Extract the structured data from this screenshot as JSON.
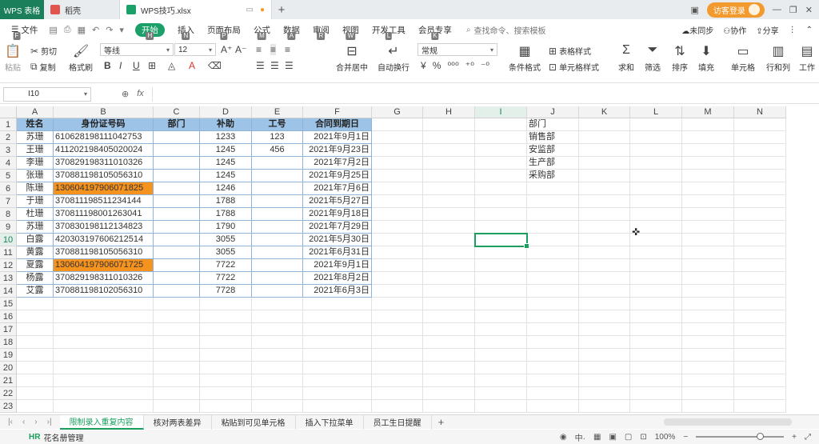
{
  "titlebar": {
    "app": "WPS 表格",
    "tabs": [
      {
        "label": "稻壳"
      },
      {
        "label": "WPS技巧.xlsx"
      }
    ],
    "new_tab": "+",
    "visitor": "访客登录"
  },
  "menu": {
    "file": "文件",
    "items": [
      {
        "label": "开始",
        "hint": "H",
        "active": true
      },
      {
        "label": "插入",
        "hint": "N"
      },
      {
        "label": "页面布局",
        "hint": "P"
      },
      {
        "label": "公式",
        "hint": "M"
      },
      {
        "label": "数据",
        "hint": "A"
      },
      {
        "label": "审阅",
        "hint": "R"
      },
      {
        "label": "视图",
        "hint": "W"
      },
      {
        "label": "开发工具",
        "hint": "L"
      },
      {
        "label": "会员专享",
        "hint": "K"
      }
    ],
    "file_hint": "F",
    "search": "查找命令、搜索模板",
    "sync": "未同步",
    "collab": "协作",
    "share": "分享"
  },
  "ribbon": {
    "paste": "粘贴",
    "cut": "剪切",
    "copy": "复制",
    "format_painter": "格式刷",
    "font_name": "等线",
    "font_size": "12",
    "merge_center": "合并居中",
    "wrap": "自动换行",
    "number_format": "常规",
    "cond_format": "条件格式",
    "table_style": "表格样式",
    "cell_style": "单元格样式",
    "sum": "求和",
    "filter": "筛选",
    "sort": "排序",
    "fill": "填充",
    "cell": "单元格",
    "row_col": "行和列",
    "work": "工作"
  },
  "formula_bar": {
    "cell_ref": "I10",
    "fx": "fx"
  },
  "columns": [
    "A",
    "B",
    "C",
    "D",
    "E",
    "F",
    "G",
    "H",
    "I",
    "J",
    "K",
    "L",
    "M",
    "N"
  ],
  "selected_column": "I",
  "selected_row": 10,
  "rows": [
    1,
    2,
    3,
    4,
    5,
    6,
    7,
    8,
    9,
    10,
    11,
    12,
    13,
    14,
    15,
    16,
    17,
    18,
    19,
    20,
    21,
    22,
    23
  ],
  "table": {
    "headers": [
      "姓名",
      "身份证号码",
      "部门",
      "补助",
      "工号",
      "合同到期日"
    ],
    "data": [
      {
        "name": "苏珊",
        "id": "610628198111042753",
        "dept": "",
        "subsidy": "1233",
        "emp_no": "123",
        "date": "2021年9月1日",
        "hl": false
      },
      {
        "name": "王珊",
        "id": "411202198405020024",
        "dept": "",
        "subsidy": "1245",
        "emp_no": "456",
        "date": "2021年9月23日",
        "hl": false
      },
      {
        "name": "李珊",
        "id": "370829198311010326",
        "dept": "",
        "subsidy": "1245",
        "emp_no": "",
        "date": "2021年7月2日",
        "hl": false
      },
      {
        "name": "张珊",
        "id": "370881198105056310",
        "dept": "",
        "subsidy": "1245",
        "emp_no": "",
        "date": "2021年9月25日",
        "hl": false
      },
      {
        "name": "陈珊",
        "id": "130604197906071825",
        "dept": "",
        "subsidy": "1246",
        "emp_no": "",
        "date": "2021年7月6日",
        "hl": true
      },
      {
        "name": "于珊",
        "id": "370811198511234144",
        "dept": "",
        "subsidy": "1788",
        "emp_no": "",
        "date": "2021年5月27日",
        "hl": false
      },
      {
        "name": "杜珊",
        "id": "370811198001263041",
        "dept": "",
        "subsidy": "1788",
        "emp_no": "",
        "date": "2021年9月18日",
        "hl": false
      },
      {
        "name": "苏珊",
        "id": "370830198112134823",
        "dept": "",
        "subsidy": "1790",
        "emp_no": "",
        "date": "2021年7月29日",
        "hl": false
      },
      {
        "name": "白露",
        "id": "420303197606212514",
        "dept": "",
        "subsidy": "3055",
        "emp_no": "",
        "date": "2021年5月30日",
        "hl": false
      },
      {
        "name": "黄露",
        "id": "370881198105056310",
        "dept": "",
        "subsidy": "3055",
        "emp_no": "",
        "date": "2021年6月31日",
        "hl": false
      },
      {
        "name": "夏露",
        "id": "130604197906071725",
        "dept": "",
        "subsidy": "7722",
        "emp_no": "",
        "date": "2021年9月1日",
        "hl": true
      },
      {
        "name": "杨露",
        "id": "370829198311010326",
        "dept": "",
        "subsidy": "7722",
        "emp_no": "",
        "date": "2021年8月2日",
        "hl": false
      },
      {
        "name": "艾露",
        "id": "370881198102056310",
        "dept": "",
        "subsidy": "7728",
        "emp_no": "",
        "date": "2021年6月3日",
        "hl": false
      }
    ]
  },
  "dept_list": [
    "部门",
    "销售部",
    "安监部",
    "生产部",
    "采购部"
  ],
  "sheets": [
    {
      "label": "限制录入重复内容",
      "active": true
    },
    {
      "label": "核对两表差异"
    },
    {
      "label": "粘贴到可见单元格"
    },
    {
      "label": "插入下拉菜单"
    },
    {
      "label": "员工生日提醒"
    }
  ],
  "status": {
    "app_label": "花名册管理",
    "zoom": "100%",
    "zoom_level": 0.73
  },
  "colors": {
    "accent": "#1a9f5e",
    "header_fill": "#9dc3e6",
    "highlight": "#f6921e"
  }
}
